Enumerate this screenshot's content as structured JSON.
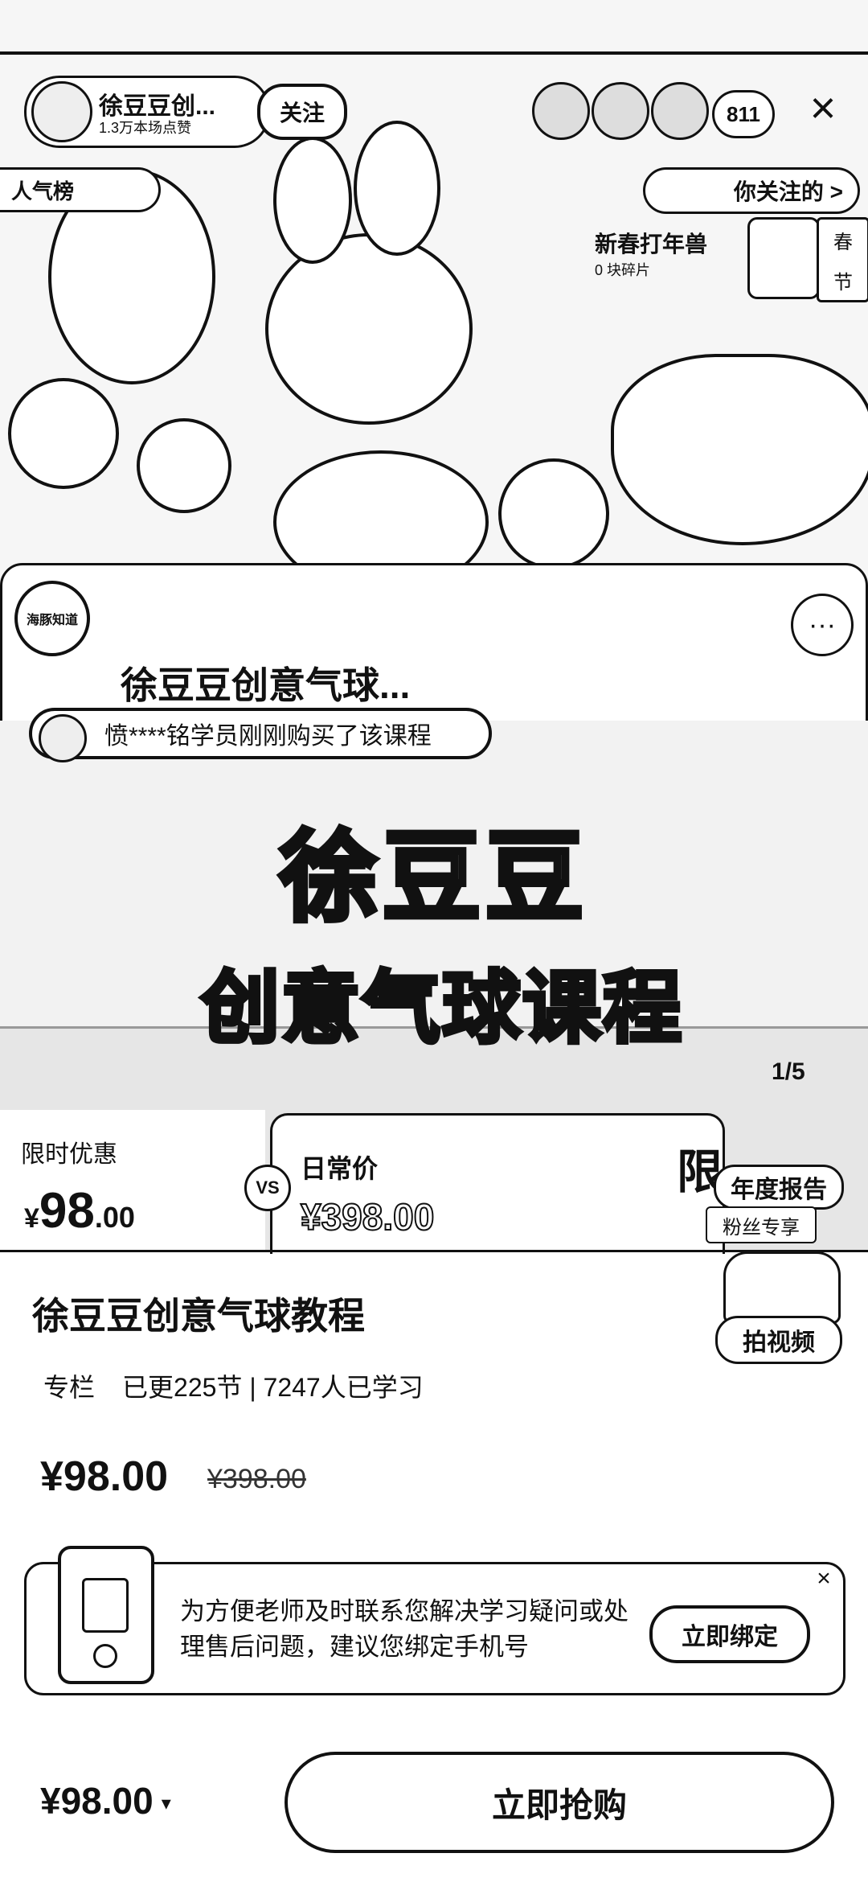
{
  "live": {
    "host_name": "徐豆豆创...",
    "host_likes": "1.3万本场点赞",
    "follow_label": "关注",
    "viewer_count": "811",
    "close_icon": "×",
    "popularity_tag": "人气榜",
    "following_tag": "你关注的 >",
    "new_year_title": "新春打年兽",
    "new_year_sub": "0 块碎片",
    "new_year_side_1": "春",
    "new_year_side_2": "节"
  },
  "course_card": {
    "logo_text": "海豚知道",
    "title": "徐豆豆创意气球...",
    "more_icon": "···"
  },
  "banner": {
    "purchase_note": "愤****铭学员刚刚购买了该课程",
    "title": "徐豆豆",
    "subtitle": "创意气球课程",
    "page_indicator": "1/5",
    "promo_limit": "限时优惠",
    "promo_currency": "¥",
    "promo_integer": "98",
    "promo_decimal": ".00",
    "vs": "VS",
    "daily_label": "日常价",
    "daily_price": "¥398.00",
    "fan_limit": "限",
    "annual_report": "年度报告",
    "fan_only": "粉丝专享"
  },
  "course": {
    "name": "徐豆豆创意气球教程",
    "type": "专栏",
    "updated": "已更225节",
    "separator": "|",
    "learners": "7247人已学习",
    "price": "¥98.00",
    "original_price": "¥398.00",
    "shoot_video": "拍视频"
  },
  "bind": {
    "text": "为方便老师及时联系您解决学习疑问或处理售后问题，建议您绑定手机号",
    "button": "立即绑定",
    "close_icon": "×"
  },
  "bottom": {
    "price": "¥98.00",
    "caret": "▾",
    "buy_label": "立即抢购"
  }
}
